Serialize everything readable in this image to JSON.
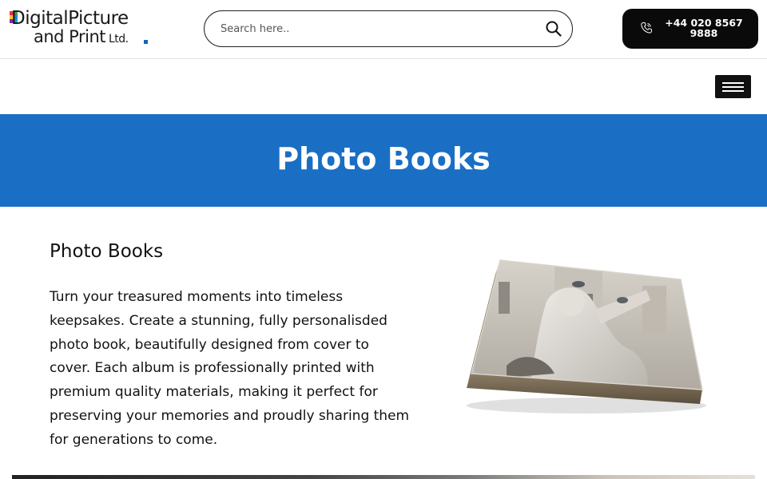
{
  "header": {
    "logo": {
      "line1": "DigitalPicture",
      "line2": "and Print",
      "ltd": "Ltd."
    },
    "search": {
      "placeholder": "Search here.."
    },
    "phone": {
      "label": "+44 020 8567 9888"
    }
  },
  "navbar": {
    "menu_icon": "hamburger-icon"
  },
  "banner": {
    "title": "Photo Books"
  },
  "content": {
    "title": "Photo Books",
    "body": "Turn your treasured moments into timeless keepsakes. Create a stunning, fully personalisded photo book, beautifully designed from cover to cover. Each album is professionally printed with premium quality materials, making it perfect for preserving your memories and proudly sharing them for generations to come."
  },
  "colors": {
    "banner": "#1a6fc4",
    "phone_button": "#0a0a0a",
    "hamburger": "#111111"
  }
}
